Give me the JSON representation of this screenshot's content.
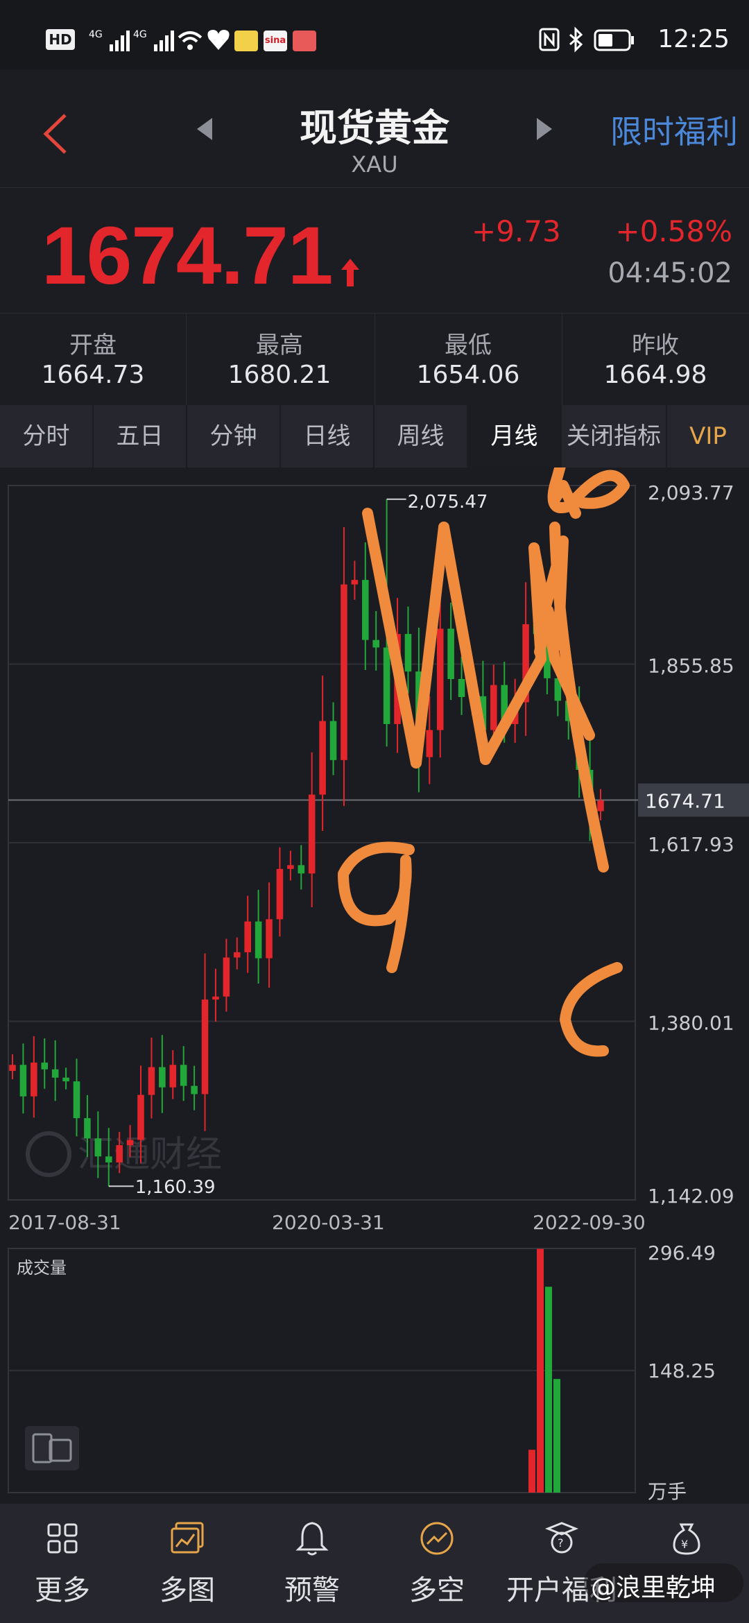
{
  "status_bar": {
    "time": "12:25",
    "icons": [
      "hd-icon",
      "signal-4g-icon",
      "signal-4g-icon",
      "wifi-icon",
      "health-icon",
      "weibo-icon",
      "sina-icon",
      "app-icon",
      "nfc-icon",
      "bluetooth-icon",
      "battery-icon"
    ],
    "hd_label": "HD",
    "sina_label": "sina"
  },
  "header": {
    "title": "现货黄金",
    "subtitle": "XAU",
    "promo": "限时福利"
  },
  "quote": {
    "price": "1674.71",
    "change": "+9.73",
    "change_pct": "+0.58%",
    "time": "04:45:02",
    "up_color": "#e3262b"
  },
  "stats": [
    {
      "label": "开盘",
      "value": "1664.73"
    },
    {
      "label": "最高",
      "value": "1680.21"
    },
    {
      "label": "最低",
      "value": "1654.06"
    },
    {
      "label": "昨收",
      "value": "1664.98"
    }
  ],
  "tabs": [
    {
      "label": "分时"
    },
    {
      "label": "五日"
    },
    {
      "label": "分钟"
    },
    {
      "label": "日线"
    },
    {
      "label": "周线"
    },
    {
      "label": "月线",
      "active": true
    },
    {
      "label": "关闭指标"
    },
    {
      "label": "VIP"
    }
  ],
  "chart_data": {
    "type": "candlestick",
    "period": "monthly",
    "y_axis_labels": [
      "2,093.77",
      "1,855.85",
      "1,617.93",
      "1,380.01",
      "1,142.09"
    ],
    "current_price_label": "1674.71",
    "x_axis_labels": [
      "2017-08-31",
      "2020-03-31",
      "2022-09-30"
    ],
    "high_annotation": "2,075.47",
    "low_annotation": "1,160.39",
    "watermark": "汇通财经",
    "ylim": [
      1142.09,
      2093.77
    ],
    "up_color": "#e3262b",
    "down_color": "#22a73a",
    "closes": [
      1322,
      1280,
      1325,
      1316,
      1305,
      1300,
      1251,
      1224,
      1200,
      1192,
      1215,
      1222,
      1282,
      1319,
      1292,
      1322,
      1294,
      1283,
      1409,
      1413,
      1465,
      1472,
      1513,
      1464,
      1516,
      1583,
      1588,
      1577,
      1682,
      1780,
      1728,
      1962,
      1968,
      1888,
      1878,
      1776,
      1896,
      1846,
      1732,
      1768,
      1903,
      1836,
      1812,
      1813,
      1768,
      1828,
      1776,
      1805,
      1909,
      1896,
      1837,
      1807,
      1780,
      1715,
      1660,
      1674
    ],
    "volume": {
      "title": "成交量",
      "y_axis_labels": [
        "296.49",
        "148.25"
      ],
      "unit": "万手",
      "bars": [
        {
          "value": 52,
          "up": true
        },
        {
          "value": 296,
          "up": true
        },
        {
          "value": 250,
          "up": false
        },
        {
          "value": 138,
          "up": false
        }
      ]
    }
  },
  "bottom_nav": [
    {
      "label": "更多",
      "icon": "grid-icon"
    },
    {
      "label": "多图",
      "icon": "multi-chart-icon"
    },
    {
      "label": "预警",
      "icon": "bell-icon"
    },
    {
      "label": "多空",
      "icon": "trend-circle-icon"
    },
    {
      "label": "开户福利",
      "icon": "gift-icon"
    },
    {
      "label": "",
      "icon": "money-bag-icon"
    }
  ],
  "overlay": {
    "weibo_handle": "@浪里乾坤"
  }
}
